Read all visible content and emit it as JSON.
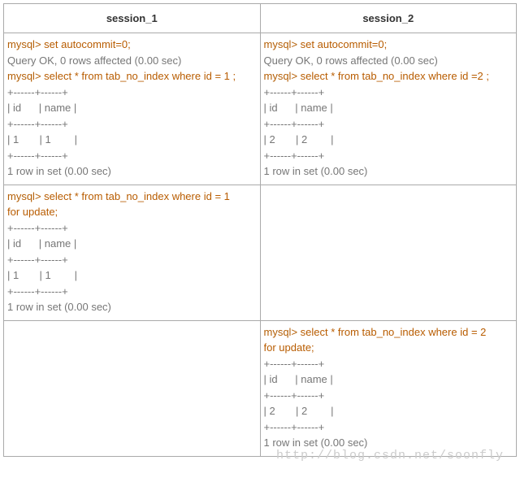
{
  "headers": {
    "col1": "session_1",
    "col2": "session_2"
  },
  "row1": {
    "s1": {
      "l1p": "mysql> ",
      "l1s": "set autocommit=0;",
      "l2": "Query OK, 0 rows affected (0.00 sec)",
      "l3p": "mysql> ",
      "l3s": "select * from tab_no_index where id = 1 ;",
      "l4": "+------+------+",
      "l5": "| id      | name |",
      "l6": "+------+------+",
      "l7": "| 1       | 1        |",
      "l8": "+------+------+",
      "l9": "1 row in set (0.00 sec)"
    },
    "s2": {
      "l1p": "mysql> ",
      "l1s": "set autocommit=0;",
      "l2": "Query OK, 0 rows affected (0.00 sec)",
      "l3p": "mysql> ",
      "l3s": "select * from tab_no_index where id =2 ;",
      "l4": "+------+------+",
      "l5": "| id      | name |",
      "l6": "+------+------+",
      "l7": "| 2       | 2        |",
      "l8": "+------+------+",
      "l9": "1 row in set (0.00 sec)"
    }
  },
  "row2": {
    "s1": {
      "l1p": "mysql> ",
      "l1s": "select * from tab_no_index where id = 1",
      "l2s": "for update;",
      "l3": "+------+------+",
      "l4": "| id      | name |",
      "l5": "+------+------+",
      "l6": "| 1       | 1        |",
      "l7": "+------+------+",
      "l8": "1 row in set (0.00 sec)"
    }
  },
  "row3": {
    "s2": {
      "l1p": "mysql> ",
      "l1s": "select * from tab_no_index where id = 2",
      "l2s": "for update;",
      "l3": "+------+------+",
      "l4": "| id      | name |",
      "l5": "+------+------+",
      "l6": "| 2       | 2        |",
      "l7": "+------+------+",
      "l8": "1 row in set (0.00 sec)"
    }
  },
  "watermark": "http://blog.csdn.net/soonfly"
}
